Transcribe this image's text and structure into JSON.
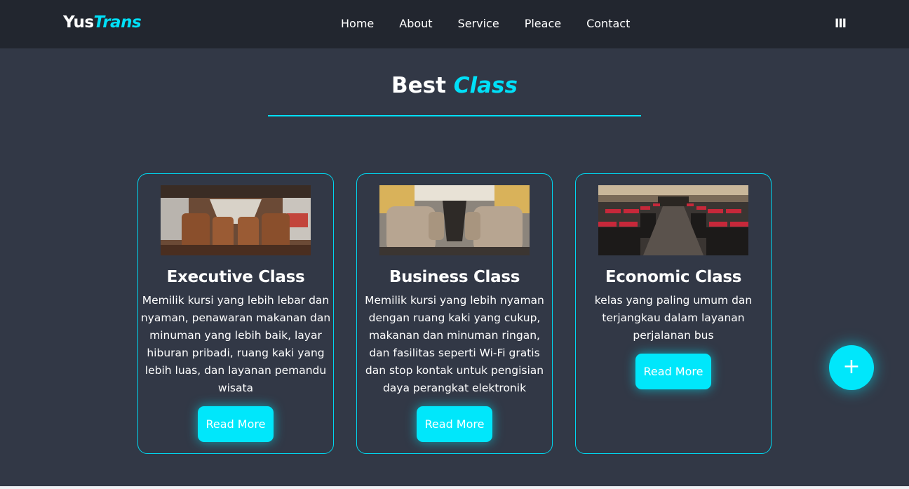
{
  "brand": {
    "part1": "Yus",
    "part2": "Trans"
  },
  "nav": {
    "links": [
      "Home",
      "About",
      "Service",
      "Pleace",
      "Contact"
    ],
    "menu_icon_glyph": "III"
  },
  "section": {
    "title_part1": "Best",
    "title_part2": "Class"
  },
  "cards": [
    {
      "title": "Executive Class",
      "description": "Memilik kursi yang lebih lebar dan nyaman, penawaran makanan dan minuman yang lebih baik, layar hiburan pribadi, ruang kaki yang lebih luas, dan layanan pemandu wisata",
      "button": "Read More",
      "image": "bus-interior-executive"
    },
    {
      "title": "Business Class",
      "description": "Memilik kursi yang lebih nyaman dengan ruang kaki yang cukup, makanan dan minuman ringan, dan fasilitas seperti Wi-Fi gratis dan stop kontak untuk pengisian daya perangkat elektronik",
      "button": "Read More",
      "image": "bus-interior-business"
    },
    {
      "title": "Economic Class",
      "description": "kelas yang paling umum dan terjangkau dalam layanan perjalanan bus",
      "button": "Read More",
      "image": "bus-interior-economic"
    }
  ],
  "fab": {
    "glyph": "+"
  },
  "colors": {
    "accent": "#00e0f8",
    "background": "#323846",
    "navbar": "#22262f"
  }
}
